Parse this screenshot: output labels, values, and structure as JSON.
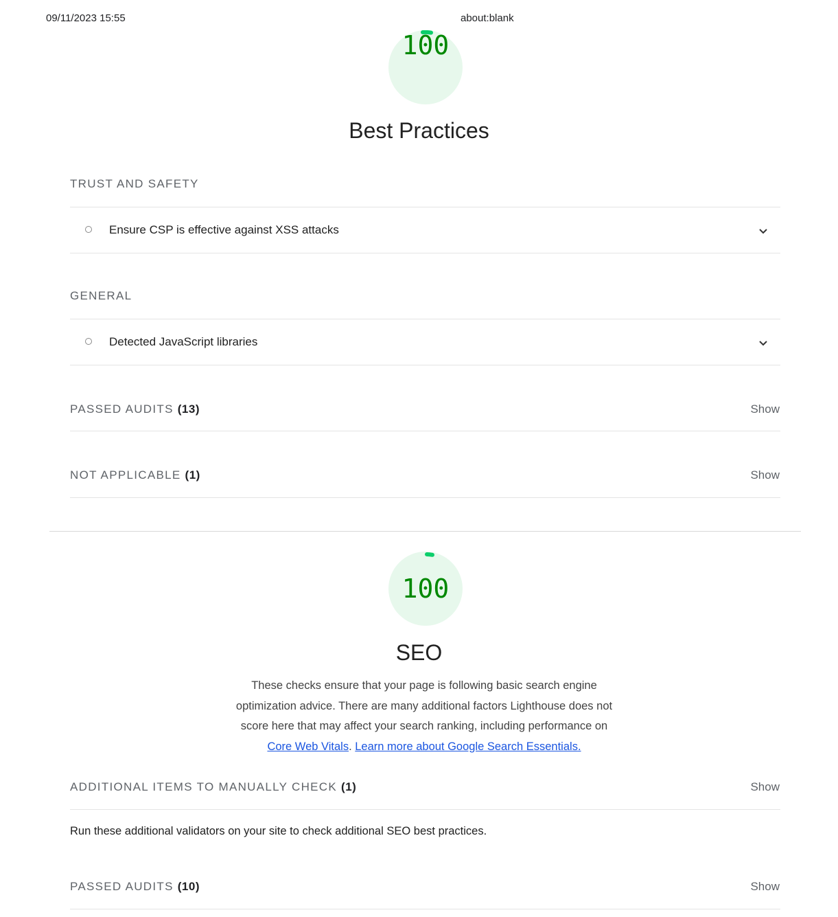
{
  "print_header": {
    "datetime": "09/11/2023 15:55",
    "url": "about:blank"
  },
  "colors": {
    "pass_green": "#008800",
    "gauge_fill": "#e7f8ec",
    "gauge_arc": "#0cce6b",
    "link_blue": "#1a55e0"
  },
  "best_practices": {
    "score": "100",
    "title": "Best Practices",
    "groups": [
      {
        "title": "TRUST AND SAFETY",
        "audits": [
          {
            "label": "Ensure CSP is effective against XSS attacks",
            "icon": "informative-circle-icon"
          }
        ]
      },
      {
        "title": "GENERAL",
        "audits": [
          {
            "label": "Detected JavaScript libraries",
            "icon": "informative-circle-icon"
          }
        ]
      }
    ],
    "passed": {
      "label": "PASSED AUDITS",
      "count": "(13)",
      "action": "Show"
    },
    "not_applicable": {
      "label": "NOT APPLICABLE",
      "count": "(1)",
      "action": "Show"
    }
  },
  "seo": {
    "score": "100",
    "title": "SEO",
    "description_lines": [
      "These checks ensure that your page is following basic search engine",
      "optimization advice. There are many additional factors Lighthouse does not",
      "score here that may affect your search ranking, including performance on"
    ],
    "link_core_web_vitals": "Core Web Vitals",
    "link_learn_more": "Learn more about Google Search Essentials",
    "manual": {
      "label": "ADDITIONAL ITEMS TO MANUALLY CHECK",
      "count": "(1)",
      "action": "Show"
    },
    "manual_note": "Run these additional validators on your site to check additional SEO best practices.",
    "passed": {
      "label": "PASSED AUDITS",
      "count": "(10)",
      "action": "Show"
    }
  }
}
